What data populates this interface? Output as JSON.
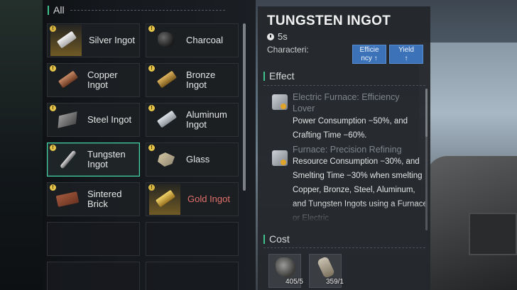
{
  "list": {
    "header": "All",
    "items": [
      {
        "label": "Silver Ingot",
        "icon": "silver-ingot-icon",
        "badge": "!",
        "selected": false
      },
      {
        "label": "Charcoal",
        "icon": "charcoal-icon",
        "badge": "!",
        "selected": false
      },
      {
        "label": "Copper Ingot",
        "icon": "copper-ingot-icon",
        "badge": "!",
        "selected": false
      },
      {
        "label": "Bronze Ingot",
        "icon": "bronze-ingot-icon",
        "badge": "!",
        "selected": false
      },
      {
        "label": "Steel Ingot",
        "icon": "steel-ingot-icon",
        "badge": "!",
        "selected": false
      },
      {
        "label": "Aluminum Ingot",
        "icon": "aluminum-ingot-icon",
        "badge": "!",
        "selected": false
      },
      {
        "label": "Tungsten Ingot",
        "icon": "tungsten-ingot-icon",
        "badge": "!",
        "selected": true
      },
      {
        "label": "Glass",
        "icon": "glass-icon",
        "badge": "!",
        "selected": false
      },
      {
        "label": "Sintered Brick",
        "icon": "sintered-brick-icon",
        "badge": "!",
        "selected": false
      },
      {
        "label": "Gold Ingot",
        "icon": "gold-ingot-icon",
        "badge": "!",
        "selected": false
      }
    ]
  },
  "detail": {
    "title": "TUNGSTEN INGOT",
    "time": "5s",
    "characteristics_label": "Characteri:",
    "tags": [
      {
        "line1": "Efficie",
        "line2": "ncy ↑"
      },
      {
        "line1": "Yield",
        "line2": "↑"
      }
    ],
    "effect_header": "Effect",
    "effects": [
      {
        "title": "Electric Furnace: Efficiency Lover",
        "text": "Power Consumption −50%, and Crafting Time −60%."
      },
      {
        "title": "Furnace: Precision Refining",
        "text": "Resource Consumption −30%, and Smelting Time −30% when smelting Copper, Bronze, Steel, Aluminum, and Tungsten Ingots using a Furnace or Electric"
      }
    ],
    "cost_header": "Cost",
    "costs": [
      {
        "count": "405/5",
        "icon": "ore-icon"
      },
      {
        "count": "359/1",
        "icon": "bottle-icon"
      }
    ]
  },
  "colors": {
    "accent": "#3fc48f",
    "selected_border": "#46d7a7",
    "tag_bg": "#3c72b8",
    "badge": "#e6c44a",
    "gold_label": "#e0706a"
  }
}
